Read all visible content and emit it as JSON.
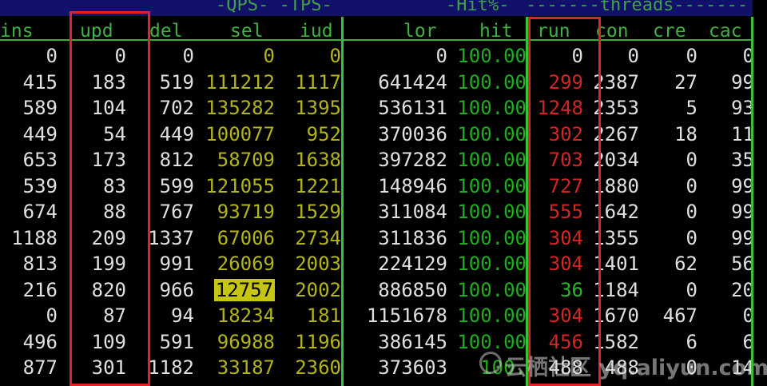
{
  "title_band": {
    "qps": "-QPS- -TPS-",
    "hit": "-Hit%-",
    "threads": "-------threads-------"
  },
  "headers": [
    "ins",
    "upd",
    "del",
    "sel",
    "iud",
    "lor",
    "hit",
    "run",
    "con",
    "cre",
    "cac"
  ],
  "rows": [
    {
      "ins": "0",
      "upd": "0",
      "del": "0",
      "sel": "0",
      "iud": "0",
      "lor": "0",
      "hit": "100.00",
      "run": "0",
      "run_color": "white",
      "con": "0",
      "cre": "0",
      "cac": "0"
    },
    {
      "ins": "415",
      "upd": "183",
      "del": "519",
      "sel": "111212",
      "iud": "1117",
      "lor": "641424",
      "hit": "100.00",
      "run": "299",
      "run_color": "red",
      "con": "2387",
      "cre": "27",
      "cac": "99"
    },
    {
      "ins": "589",
      "upd": "104",
      "del": "702",
      "sel": "135282",
      "iud": "1395",
      "lor": "536131",
      "hit": "100.00",
      "run": "1248",
      "run_color": "red",
      "con": "2353",
      "cre": "5",
      "cac": "93"
    },
    {
      "ins": "449",
      "upd": "54",
      "del": "449",
      "sel": "100077",
      "iud": "952",
      "lor": "370036",
      "hit": "100.00",
      "run": "302",
      "run_color": "red",
      "con": "2267",
      "cre": "18",
      "cac": "11"
    },
    {
      "ins": "653",
      "upd": "173",
      "del": "812",
      "sel": "58709",
      "iud": "1638",
      "lor": "397282",
      "hit": "100.00",
      "run": "703",
      "run_color": "red",
      "con": "2034",
      "cre": "0",
      "cac": "35"
    },
    {
      "ins": "539",
      "upd": "83",
      "del": "599",
      "sel": "121055",
      "iud": "1221",
      "lor": "148946",
      "hit": "100.00",
      "run": "727",
      "run_color": "red",
      "con": "1880",
      "cre": "0",
      "cac": "99"
    },
    {
      "ins": "674",
      "upd": "88",
      "del": "767",
      "sel": "93719",
      "iud": "1529",
      "lor": "311084",
      "hit": "100.00",
      "run": "555",
      "run_color": "red",
      "con": "1642",
      "cre": "0",
      "cac": "99"
    },
    {
      "ins": "1188",
      "upd": "209",
      "del": "1337",
      "sel": "67006",
      "iud": "2734",
      "lor": "311836",
      "hit": "100.00",
      "run": "304",
      "run_color": "red",
      "con": "1355",
      "cre": "0",
      "cac": "99"
    },
    {
      "ins": "813",
      "upd": "199",
      "del": "991",
      "sel": "26069",
      "iud": "2003",
      "lor": "224129",
      "hit": "100.00",
      "run": "304",
      "run_color": "red",
      "con": "1401",
      "cre": "62",
      "cac": "56"
    },
    {
      "ins": "216",
      "upd": "820",
      "del": "966",
      "sel": "12757",
      "iud": "2002",
      "lor": "886850",
      "hit": "100.00",
      "run": "36",
      "run_color": "green",
      "con": "1184",
      "cre": "0",
      "cac": "20",
      "sel_highlight": true
    },
    {
      "ins": "0",
      "upd": "87",
      "del": "94",
      "sel": "18234",
      "iud": "181",
      "lor": "1151678",
      "hit": "100.00",
      "run": "304",
      "run_color": "red",
      "con": "1670",
      "cre": "467",
      "cac": "0"
    },
    {
      "ins": "496",
      "upd": "109",
      "del": "591",
      "sel": "96988",
      "iud": "1196",
      "lor": "386145",
      "hit": "100.00",
      "run": "456",
      "run_color": "red",
      "con": "1582",
      "cre": "6",
      "cac": "6"
    },
    {
      "ins": "877",
      "upd": "301",
      "del": "1182",
      "sel": "33187",
      "iud": "2360",
      "lor": "373603",
      "hit": "100.",
      "run": "488",
      "run_color": "white",
      "con": "488",
      "cre": "0",
      "cac": "14"
    }
  ],
  "watermark": "云栖社区 yq.aliyun.com"
}
